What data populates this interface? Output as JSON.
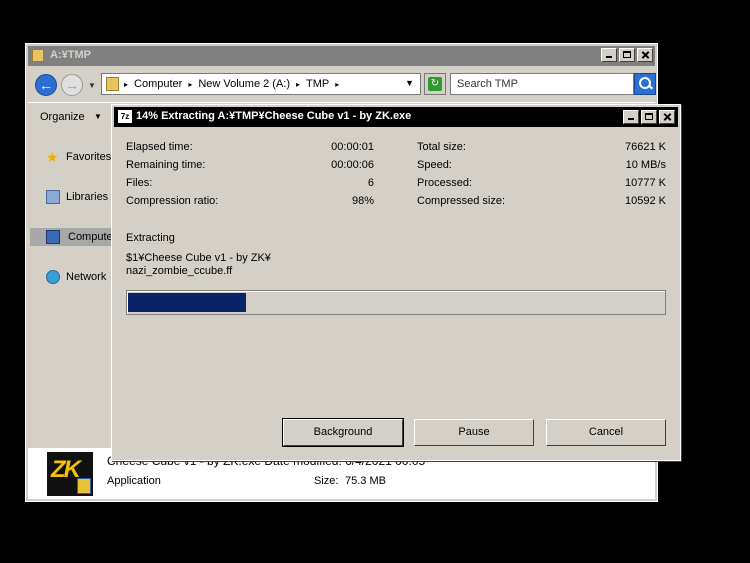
{
  "explorer": {
    "title": "A:¥TMP",
    "breadcrumbs": [
      "Computer",
      "New Volume 2 (A:)",
      "TMP"
    ],
    "search_placeholder": "Search TMP",
    "toolbar": {
      "organize": "Organize"
    },
    "nav": [
      {
        "label": "Favorites",
        "icon": "star-icon"
      },
      {
        "label": "Libraries",
        "icon": "libraries-icon"
      },
      {
        "label": "Computer",
        "icon": "computer-icon",
        "selected": true
      },
      {
        "label": "Network",
        "icon": "network-icon"
      }
    ],
    "details": {
      "file_name_line": "Cheese Cube v1 - by ZK.exe  Date modified: 6/4/2021 00:05",
      "file_type": "Application",
      "size_label": "Size:",
      "size_value": "75.3 MB",
      "icon_text": "ZK"
    }
  },
  "dialog": {
    "title": "14% Extracting A:¥TMP¥Cheese Cube v1 - by ZK.exe",
    "icon_text": "7z",
    "progress_fraction": 0.22,
    "left_stats": [
      {
        "label": "Elapsed time:",
        "value": "00:00:01"
      },
      {
        "label": "Remaining time:",
        "value": "00:00:06"
      },
      {
        "label": "Files:",
        "value": "6"
      },
      {
        "label": "Compression ratio:",
        "value": "98%"
      }
    ],
    "right_stats": [
      {
        "label": "Total size:",
        "value": "76621 K"
      },
      {
        "label": "Speed:",
        "value": "10 MB/s"
      },
      {
        "label": "Processed:",
        "value": "10777 K"
      },
      {
        "label": "Compressed size:",
        "value": "10592 K"
      }
    ],
    "extracting_label": "Extracting",
    "current_path_line1": "$1¥Cheese Cube v1 - by ZK¥",
    "current_path_line2": "nazi_zombie_ccube.ff",
    "buttons": {
      "background": "Background",
      "pause": "Pause",
      "cancel": "Cancel"
    }
  },
  "colors": {
    "progress_fill": "#0a246a",
    "dialog_title_bg": "#000000",
    "window_face": "#d4d0c8"
  }
}
